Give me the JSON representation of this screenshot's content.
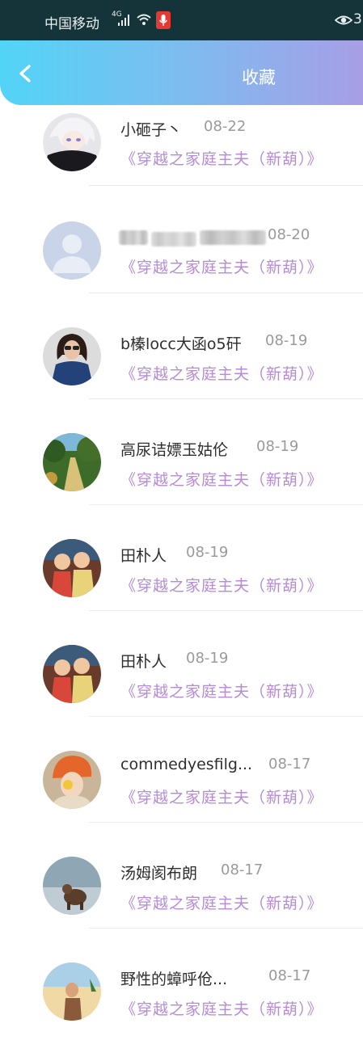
{
  "status_bar": {
    "carrier": "中国移动",
    "network": "4G",
    "eye_count": "3"
  },
  "header": {
    "title": "收藏"
  },
  "colors": {
    "header_start": "#52d4f7",
    "header_end": "#a79ee6",
    "book_title": "#b58bd8",
    "status_bg": "#153439"
  },
  "favorites": [
    {
      "name": "小砸子丶",
      "date": "08-22",
      "book": "《穿越之家庭主夫（新葫）》",
      "avatar": "anime-character-avatar"
    },
    {
      "name": "",
      "date": "08-20",
      "book": "《穿越之家庭主夫（新葫）》",
      "avatar": "default-user-avatar"
    },
    {
      "name": "b榛locc大函o5矸",
      "date": "08-19",
      "book": "《穿越之家庭主夫（新葫）》",
      "avatar": "woman-sunglasses-avatar"
    },
    {
      "name": "高尿诘嫖玉姑伦",
      "date": "08-19",
      "book": "《穿越之家庭主夫（新葫）》",
      "avatar": "forest-path-avatar"
    },
    {
      "name": "田朴人",
      "date": "08-19",
      "book": "《穿越之家庭主夫（新葫）》",
      "avatar": "two-kids-avatar"
    },
    {
      "name": "田朴人",
      "date": "08-19",
      "book": "《穿越之家庭主夫（新葫）》",
      "avatar": "two-kids-avatar"
    },
    {
      "name": "commedyesfilg...",
      "date": "08-17",
      "book": "《穿越之家庭主夫（新葫）》",
      "avatar": "orange-hat-girl-avatar"
    },
    {
      "name": "汤姆阂布朗",
      "date": "08-17",
      "book": "《穿越之家庭主夫（新葫）》",
      "avatar": "dog-seascape-avatar"
    },
    {
      "name": "野性的蟑呼伧...",
      "date": "08-17",
      "book": "《穿越之家庭主夫（新葫）》",
      "avatar": "beach-girl-avatar"
    }
  ]
}
